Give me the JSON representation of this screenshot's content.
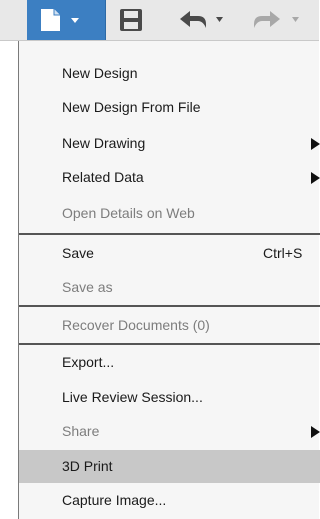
{
  "toolbar": {
    "buttons": [
      {
        "icon": "file-icon",
        "active": true
      },
      {
        "icon": "save-icon"
      },
      {
        "icon": "undo-icon"
      },
      {
        "icon": "redo-icon"
      }
    ],
    "active_color": "#3c7fc2"
  },
  "menu": {
    "items": [
      {
        "label": "New Design"
      },
      {
        "label": "New Design From File"
      },
      {
        "label": "New Drawing",
        "submenu": true
      },
      {
        "label": "Related Data",
        "submenu": true
      },
      {
        "label": "Open Details on Web",
        "disabled": true
      },
      {
        "label": "Save",
        "shortcut": "Ctrl+S"
      },
      {
        "label": "Save as",
        "disabled": true
      },
      {
        "label": "Recover Documents (0)",
        "disabled": true
      },
      {
        "label": "Export..."
      },
      {
        "label": "Live Review Session..."
      },
      {
        "label": "Share",
        "disabled": true,
        "submenu": true
      },
      {
        "label": "3D Print",
        "highlighted": true
      },
      {
        "label": "Capture Image..."
      }
    ]
  }
}
